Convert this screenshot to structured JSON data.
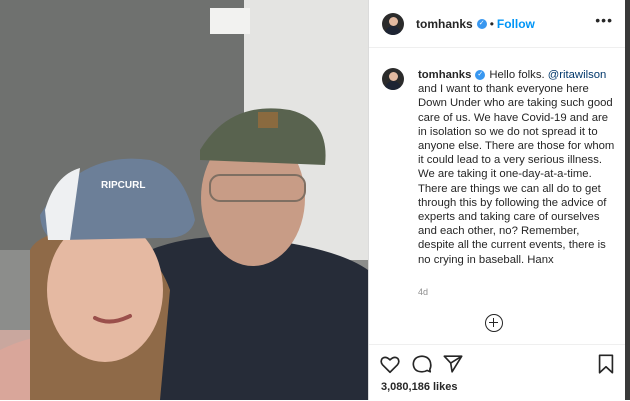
{
  "post": {
    "username": "tomhanks",
    "follow_label": "Follow",
    "separator": "•",
    "more_label": "•••",
    "verified_glyph": "✓",
    "caption_parts": {
      "intro": "Hello folks. ",
      "mention": "@ritawilson",
      "rest": " and I want to thank everyone here Down Under who are taking such good care of us. We have Covid-19 and are in isolation so we do not spread it to anyone else. There are those for whom it could lead to a very serious illness. We are taking it one-day-at-a-time. There are things we can all do to get through this by following the advice of experts and taking care of ourselves and each other, no? Remember, despite all the current events, there is no crying in baseball. Hanx"
    },
    "age": "4d",
    "likes": "3,080,186 likes",
    "cap_text": "RIPCURL"
  },
  "icons": {
    "like": "heart-icon",
    "comment": "comment-icon",
    "share": "share-icon",
    "save": "bookmark-icon",
    "add_comment": "add-circle-icon",
    "verified": "verified-badge-icon"
  },
  "colors": {
    "link_blue": "#0095f6",
    "verified_blue": "#3897f0",
    "text": "#262626",
    "muted": "#8e8e8e"
  }
}
